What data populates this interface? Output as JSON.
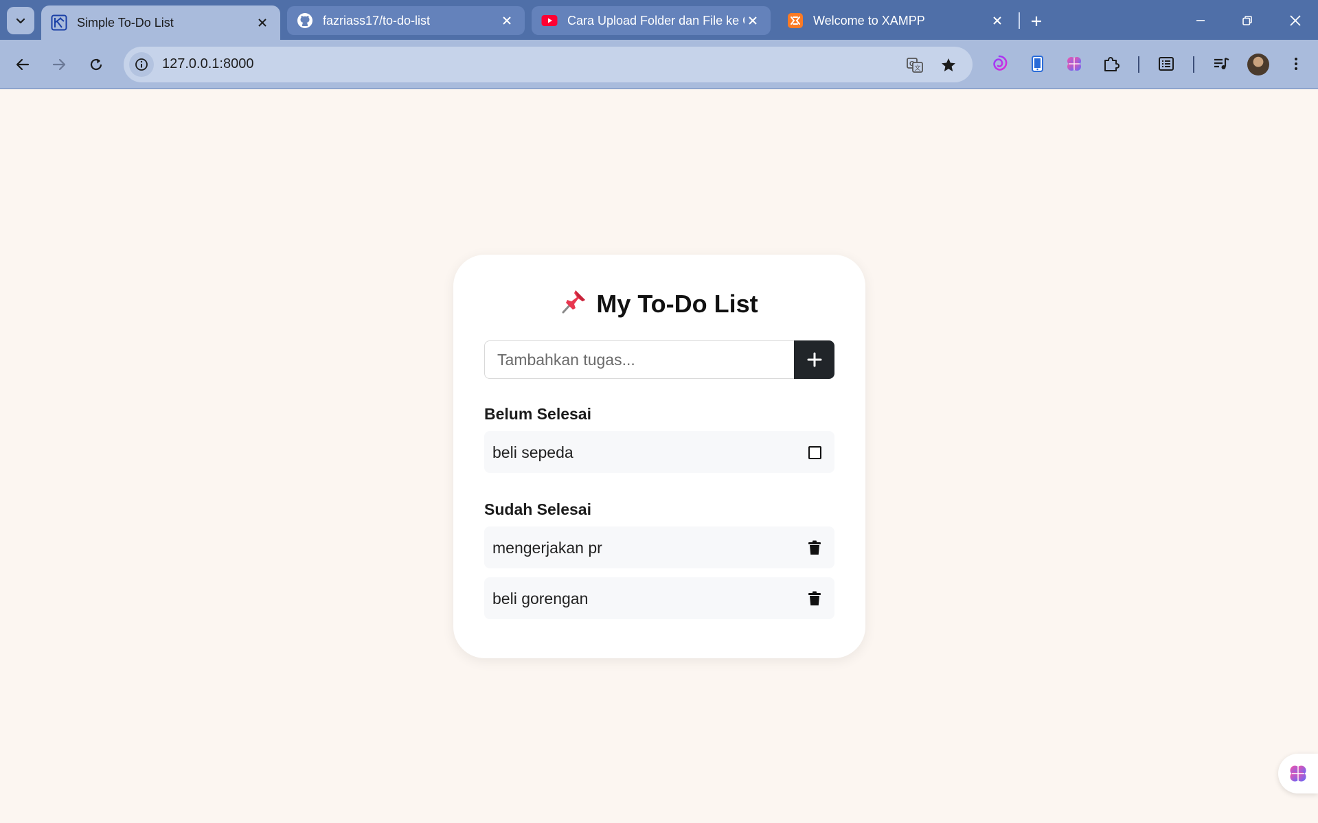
{
  "browser": {
    "tabs": [
      {
        "title": "Simple To-Do List",
        "icon": "app-icon",
        "active": true
      },
      {
        "title": "fazriass17/to-do-list",
        "icon": "github-icon",
        "active": false
      },
      {
        "title": "Cara Upload Folder dan File ke G",
        "icon": "youtube-icon",
        "active": false
      },
      {
        "title": "Welcome to XAMPP",
        "icon": "xampp-icon",
        "active": false
      }
    ],
    "url": "127.0.0.1:8000"
  },
  "app": {
    "title": "My To-Do List",
    "title_icon": "pushpin-icon",
    "input": {
      "placeholder": "Tambahkan tugas...",
      "value": ""
    },
    "add_button_icon": "plus-icon",
    "pending": {
      "heading": "Belum Selesai",
      "items": [
        {
          "text": "beli sepeda",
          "action": "checkbox"
        }
      ]
    },
    "done": {
      "heading": "Sudah Selesai",
      "items": [
        {
          "text": "mengerjakan pr",
          "action": "trash-icon"
        },
        {
          "text": "beli gorengan",
          "action": "trash-icon"
        }
      ]
    }
  },
  "colors": {
    "page_background": "#fcf6f1",
    "card_background": "#ffffff",
    "button_dark": "#212529",
    "item_background": "#f7f8fa",
    "tabbar": "#4f6fa8",
    "toolbar": "#a9bbdc"
  }
}
